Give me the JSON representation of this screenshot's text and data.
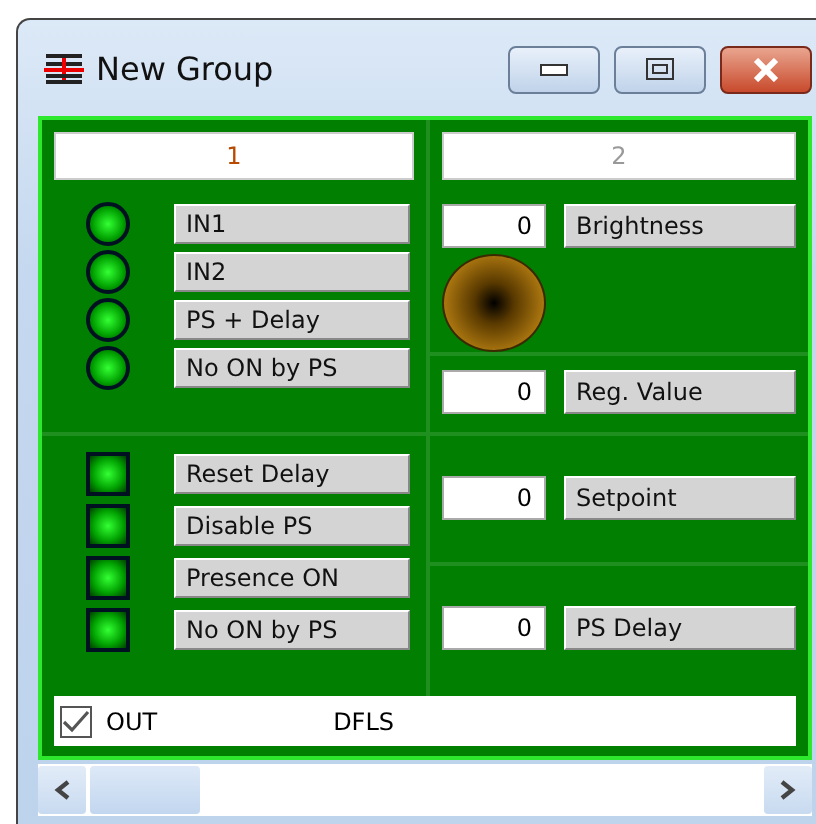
{
  "window": {
    "title": "New Group"
  },
  "tabs": [
    {
      "label": "1",
      "selected": true
    },
    {
      "label": "2",
      "selected": false
    }
  ],
  "inputs": [
    "IN1",
    "IN2",
    "PS + Delay",
    "No ON by PS"
  ],
  "outputs": [
    "Reset Delay",
    "Disable PS",
    "Presence ON",
    "No ON by PS"
  ],
  "values": [
    {
      "value": "0",
      "label": "Brightness"
    },
    {
      "value": "0",
      "label": "Reg. Value"
    },
    {
      "value": "0",
      "label": "Setpoint"
    },
    {
      "value": "0",
      "label": "PS Delay"
    }
  ],
  "status": {
    "checked": true,
    "label": "OUT",
    "name": "DFLS"
  }
}
